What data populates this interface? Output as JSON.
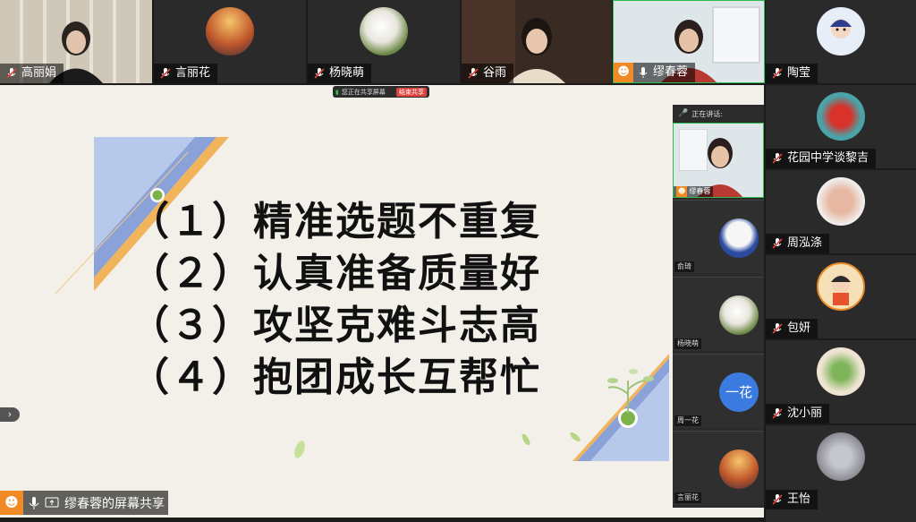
{
  "top_participants": [
    {
      "name": "高丽娟"
    },
    {
      "name": "言丽花"
    },
    {
      "name": "杨晓萌"
    },
    {
      "name": "谷雨"
    },
    {
      "name": "缪春蓉"
    }
  ],
  "right_participants": [
    {
      "name": "陶莹"
    },
    {
      "name": "花园中学谈黎吉"
    },
    {
      "name": "周泓涤"
    },
    {
      "name": "包妍"
    },
    {
      "name": "沈小丽"
    },
    {
      "name": "王怡"
    }
  ],
  "share_bar": {
    "status": "您正在共享屏幕",
    "stop_label": "结束共享"
  },
  "slide": {
    "lines": [
      "（１）精准选题不重复",
      "（２）认真准备质量好",
      "（３）攻坚克难斗志高",
      "（４）抱团成长互帮忙"
    ]
  },
  "side_panel": {
    "speaking_label": "正在讲话:",
    "speaker_name": "缪春蓉",
    "tiles": [
      {
        "name": "俞琦"
      },
      {
        "name": "杨晓萌"
      },
      {
        "name": "周一花",
        "avatar_text": "一花"
      },
      {
        "name": "言丽花"
      }
    ]
  },
  "bottom_bar": {
    "share_label": "缪春蓉的屏幕共享"
  },
  "colors": {
    "accent_green": "#2dbb4e",
    "stop_red": "#e0433b",
    "slide_bg": "#f2f0e8",
    "stripe_blue": "#8aa2d8",
    "stripe_orange": "#f2b45a"
  }
}
